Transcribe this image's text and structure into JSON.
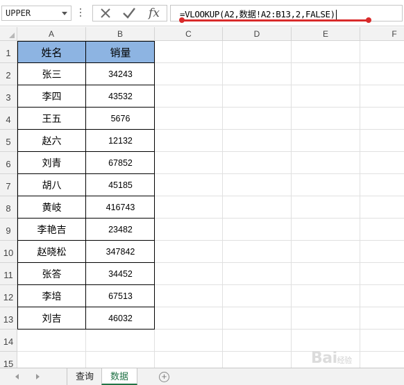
{
  "formula_bar": {
    "name_box_value": "UPPER",
    "cancel_icon": "close-icon",
    "enter_icon": "check-icon",
    "function_label": "fx",
    "formula": "=VLOOKUP(A2,数据!A2:B13,2,FALSE)"
  },
  "columns": [
    "A",
    "B",
    "C",
    "D",
    "E",
    "F"
  ],
  "rows": [
    "1",
    "2",
    "3",
    "4",
    "5",
    "6",
    "7",
    "8",
    "9",
    "10",
    "11",
    "12",
    "13",
    "14",
    "15"
  ],
  "table": {
    "headers": [
      "姓名",
      "销量"
    ],
    "rows": [
      [
        "张三",
        "34243"
      ],
      [
        "李四",
        "43532"
      ],
      [
        "王五",
        "5676"
      ],
      [
        "赵六",
        "12132"
      ],
      [
        "刘青",
        "67852"
      ],
      [
        "胡八",
        "45185"
      ],
      [
        "黄岐",
        "416743"
      ],
      [
        "李艳吉",
        "23482"
      ],
      [
        "赵晓松",
        "347842"
      ],
      [
        "张答",
        "34452"
      ],
      [
        "李培",
        "67513"
      ],
      [
        "刘吉",
        "46032"
      ]
    ]
  },
  "sheet_tabs": [
    {
      "label": "查询",
      "active": false
    },
    {
      "label": "数据",
      "active": true
    }
  ],
  "add_sheet_label": "+",
  "watermark": {
    "brand": "Bai",
    "sub": "经验"
  },
  "colors": {
    "header_fill": "#8db4e2",
    "annotation_red": "#d92b2b",
    "active_tab": "#217346"
  }
}
